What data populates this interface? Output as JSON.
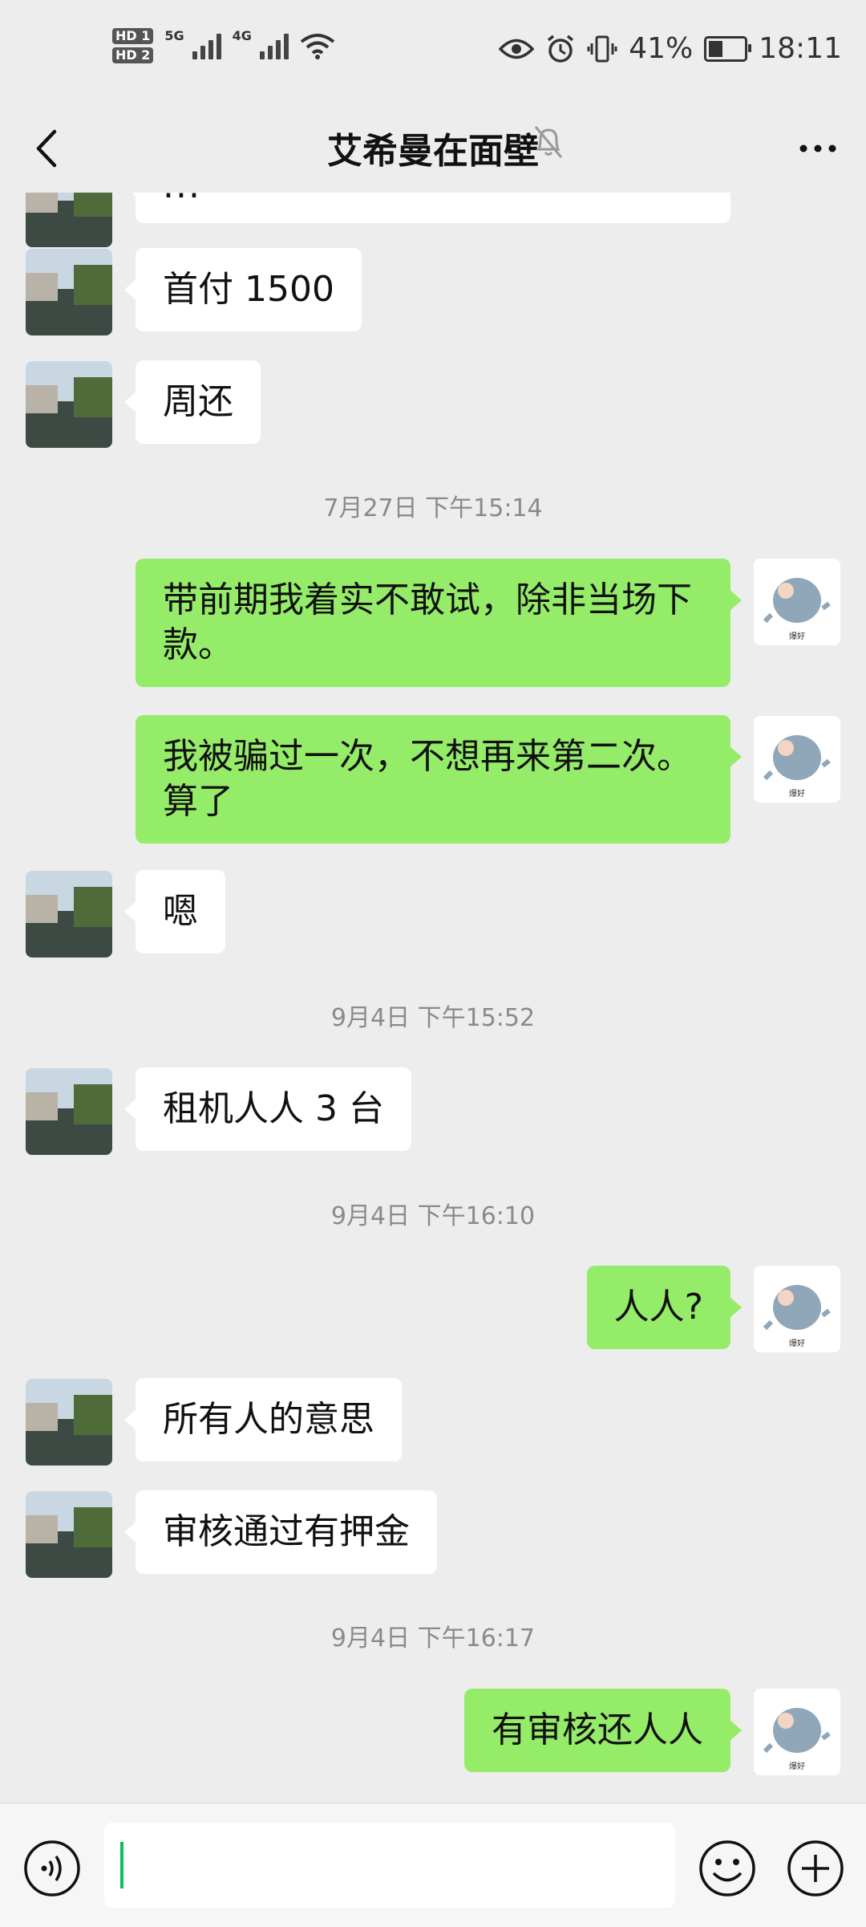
{
  "status_bar": {
    "sim1": "HD 1",
    "sim2": "HD 2",
    "net1": "5G",
    "net2": "4G",
    "battery": "41%",
    "time": "18:11"
  },
  "header": {
    "title": "艾希曼在面壁"
  },
  "messages": {
    "m0_partial": "...",
    "m1": "首付 1500",
    "m2": "周还",
    "t1": "7月27日 下午15:14",
    "m3": "带前期我着实不敢试，除非当场下款。",
    "m4": "我被骗过一次，不想再来第二次。算了",
    "m5": "嗯",
    "t2": "9月4日 下午15:52",
    "m6": "租机人人 3 台",
    "t3": "9月4日 下午16:10",
    "m7": "人人?",
    "m8": "所有人的意思",
    "m9": "审核通过有押金",
    "t4": "9月4日 下午16:17",
    "m10": "有审核还人人"
  },
  "self_avatar_label": "爆好",
  "colors": {
    "background": "#ededed",
    "incoming_bubble": "#ffffff",
    "outgoing_bubble": "#95ec69",
    "caret": "#07c160"
  }
}
